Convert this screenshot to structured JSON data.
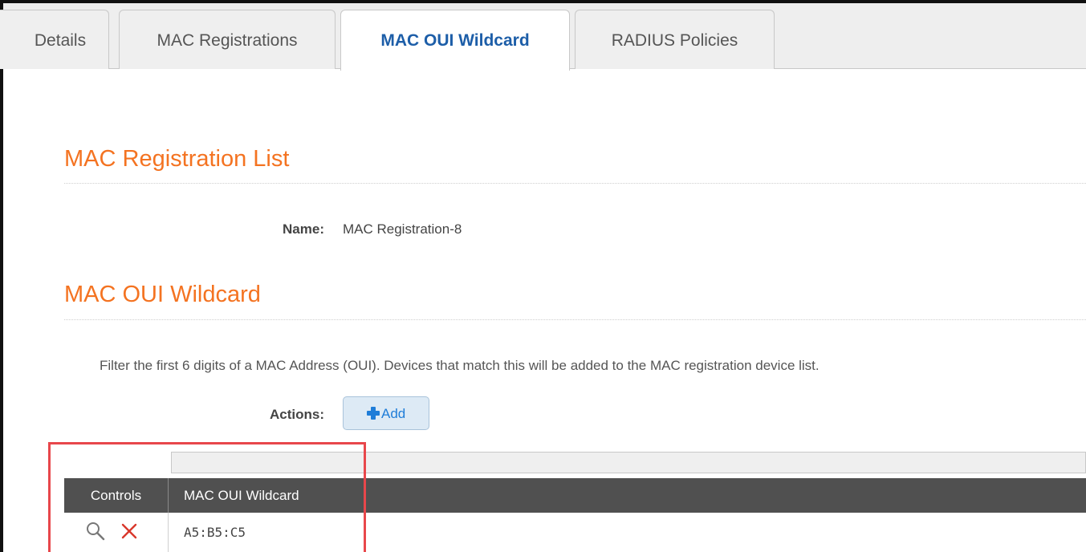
{
  "tabs": [
    {
      "label": "Details",
      "active": false
    },
    {
      "label": "MAC Registrations",
      "active": false
    },
    {
      "label": "MAC OUI Wildcard",
      "active": true
    },
    {
      "label": "RADIUS Policies",
      "active": false
    }
  ],
  "registration_list": {
    "title": "MAC Registration List",
    "name_label": "Name:",
    "name_value": "MAC Registration-8"
  },
  "oui_section": {
    "title": "MAC OUI Wildcard",
    "description": "Filter the first 6 digits of a MAC Address (OUI). Devices that match this will be added to the MAC registration device list.",
    "actions_label": "Actions:",
    "add_button_label": "Add"
  },
  "table": {
    "columns": [
      "Controls",
      "MAC OUI Wildcard"
    ],
    "rows": [
      {
        "oui": "A5:B5:C5",
        "controls": [
          "search-icon",
          "delete-icon"
        ]
      }
    ]
  },
  "colors": {
    "accent_orange": "#f47321",
    "active_tab_blue": "#1d5ea8",
    "add_button_blue": "#1f7dd8",
    "table_header": "#505050",
    "highlight_red": "#e8474b"
  }
}
